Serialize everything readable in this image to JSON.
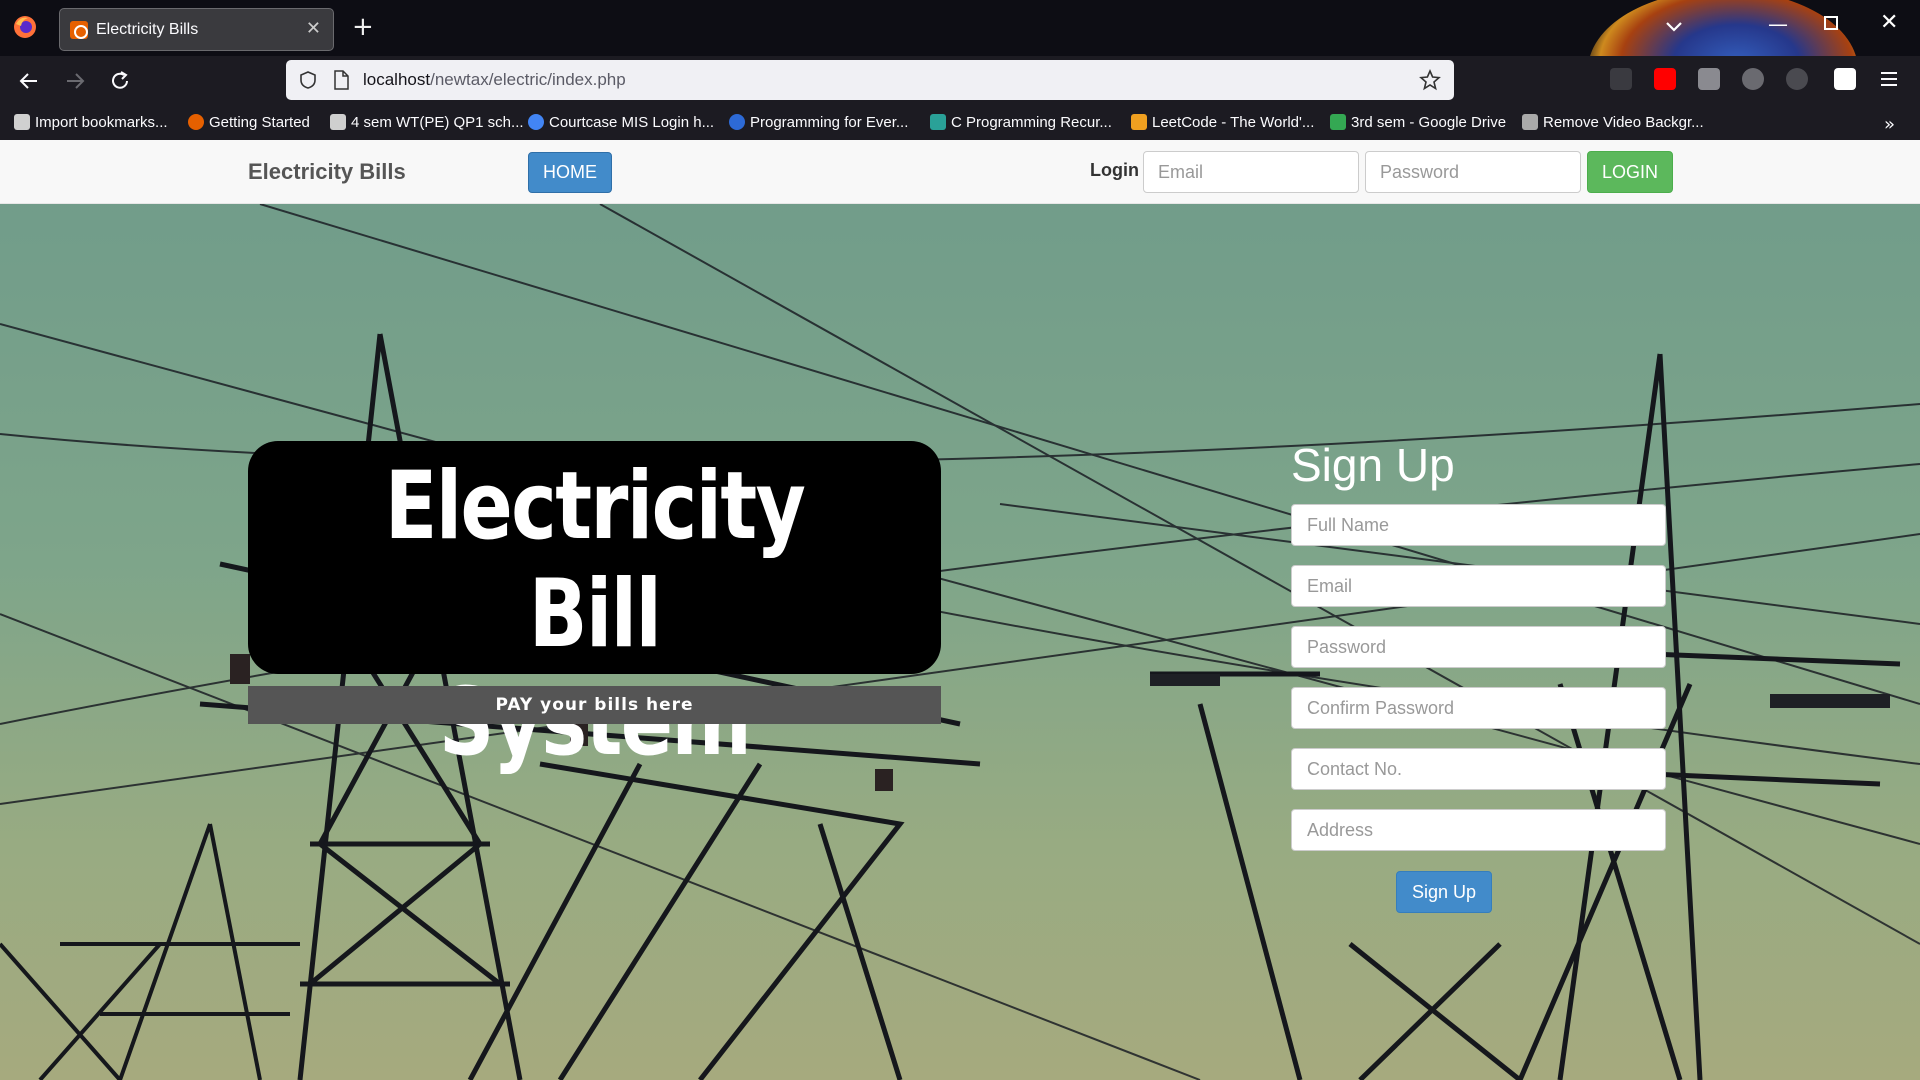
{
  "browser": {
    "tab_title": "Electricity Bills",
    "tab_close": "✕",
    "new_tab": "+",
    "url_host": "localhost",
    "url_path": "/newtax/electric/index.php",
    "window": {
      "minimize": "—",
      "close": "✕"
    },
    "bookmarks": [
      {
        "label": "Import bookmarks...",
        "icon": "import-icon",
        "color": "#d0d0d0"
      },
      {
        "label": "Getting Started",
        "icon": "firefox-icon",
        "color": "#e66000"
      },
      {
        "label": "4 sem WT(PE) QP1 sch...",
        "icon": "document-icon",
        "color": "#cfcfcf"
      },
      {
        "label": "Courtcase MIS Login h...",
        "icon": "google-icon",
        "color": "#4285f4"
      },
      {
        "label": "Programming for Ever...",
        "icon": "c-icon",
        "color": "#2d6ad6"
      },
      {
        "label": "C Programming Recur...",
        "icon": "site-icon",
        "color": "#2aa198"
      },
      {
        "label": "LeetCode - The World'...",
        "icon": "leetcode-icon",
        "color": "#f0a020"
      },
      {
        "label": "3rd sem - Google Drive",
        "icon": "google-drive-icon",
        "color": "#34a853"
      },
      {
        "label": "Remove Video Backgr...",
        "icon": "video-icon",
        "color": "#aaaaaa"
      }
    ],
    "more_bookmarks": "»"
  },
  "site": {
    "brand": "Electricity Bills",
    "home_label": "HOME",
    "login_label": "Login",
    "login_email_placeholder": "Email",
    "login_password_placeholder": "Password",
    "login_button": "LOGIN"
  },
  "hero": {
    "title_line1": "Electricity Bill",
    "title_line2": "System",
    "subtitle": "PAY your bills here"
  },
  "signup": {
    "title": "Sign Up",
    "fields": [
      {
        "placeholder": "Full Name"
      },
      {
        "placeholder": "Email"
      },
      {
        "placeholder": "Password"
      },
      {
        "placeholder": "Confirm Password"
      },
      {
        "placeholder": "Contact No."
      },
      {
        "placeholder": "Address"
      }
    ],
    "button": "Sign Up"
  },
  "colors": {
    "primary": "#428bca",
    "success": "#5cb85c",
    "hero_bg": "#000000",
    "sky_top": "#6f9b8a",
    "sky_bottom": "#a6aa7e"
  }
}
